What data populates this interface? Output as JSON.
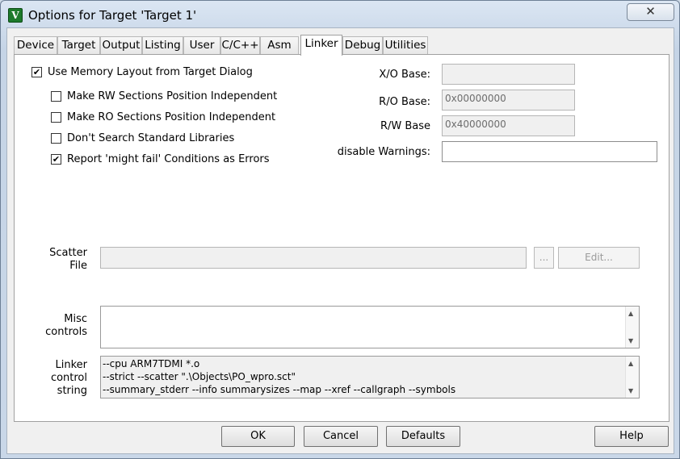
{
  "window": {
    "title": "Options for Target 'Target 1'",
    "app_icon_glyph": "V",
    "close_glyph": "✕"
  },
  "tabs": [
    "Device",
    "Target",
    "Output",
    "Listing",
    "User",
    "C/C++",
    "Asm",
    "Linker",
    "Debug",
    "Utilities"
  ],
  "active_tab": "Linker",
  "options": {
    "use_memory_layout": {
      "label": "Use Memory Layout from Target Dialog",
      "checked": true
    },
    "rw_independent": {
      "label": "Make RW Sections Position Independent",
      "checked": false
    },
    "ro_independent": {
      "label": "Make RO Sections Position Independent",
      "checked": false
    },
    "no_std_libs": {
      "label": "Don't Search Standard Libraries",
      "checked": false
    },
    "might_fail": {
      "label": "Report 'might fail' Conditions as Errors",
      "checked": true
    }
  },
  "addresses": {
    "xo_label": "X/O Base:",
    "xo_value": "",
    "ro_label": "R/O Base:",
    "ro_value": "0x00000000",
    "rw_label": "R/W Base",
    "rw_value": "0x40000000",
    "warnings_label": "disable Warnings:",
    "warnings_value": ""
  },
  "scatter": {
    "label_line1": "Scatter",
    "label_line2": "File",
    "value": "",
    "browse_label": "...",
    "edit_label": "Edit..."
  },
  "misc": {
    "label_line1": "Misc",
    "label_line2": "controls",
    "value": ""
  },
  "linker": {
    "label_line1": "Linker",
    "label_line2": "control",
    "label_line3": "string",
    "lines": [
      "--cpu ARM7TDMI *.o",
      "--strict --scatter \".\\Objects\\PO_wpro.sct\"",
      "--summary_stderr --info summarysizes --map --xref --callgraph --symbols"
    ]
  },
  "buttons": {
    "ok": "OK",
    "cancel": "Cancel",
    "defaults": "Defaults",
    "help": "Help"
  }
}
